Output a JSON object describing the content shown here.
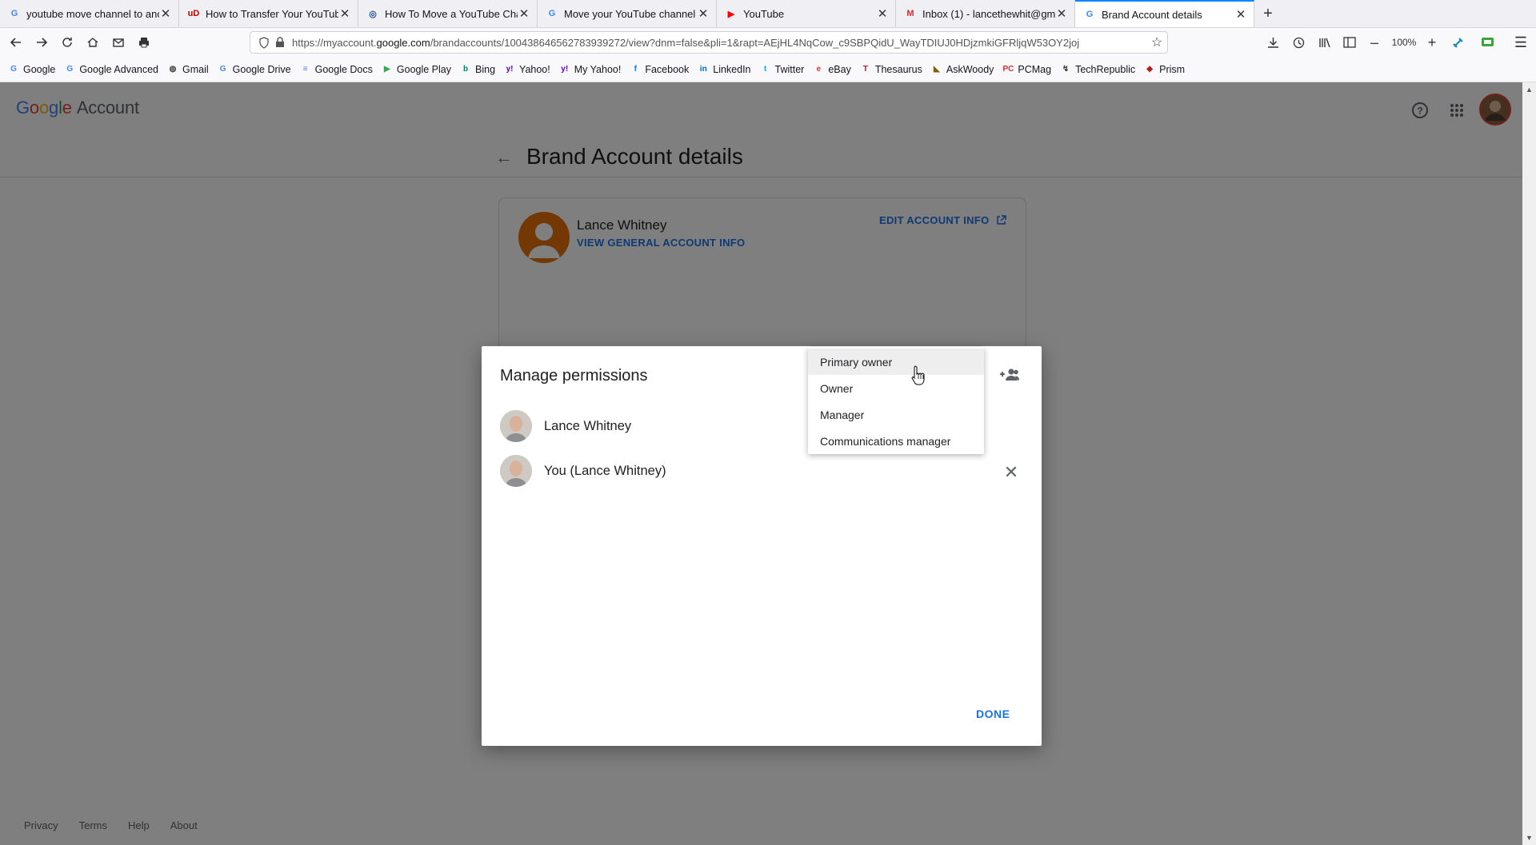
{
  "browser": {
    "tabs": [
      {
        "title": "youtube move channel to anot",
        "favicon": "google-icon",
        "favicon_glyph": "G",
        "favicon_color": "#4285f4"
      },
      {
        "title": "How to Transfer Your YouTube",
        "favicon": "ublock-icon",
        "favicon_glyph": "uD",
        "favicon_color": "#cc0000"
      },
      {
        "title": "How To Move a YouTube Chan",
        "favicon": "globe-icon",
        "favicon_glyph": "◎",
        "favicon_color": "#1a4fa0"
      },
      {
        "title": "Move your YouTube channel to",
        "favicon": "google-icon",
        "favicon_glyph": "G",
        "favicon_color": "#4285f4"
      },
      {
        "title": "YouTube",
        "favicon": "youtube-icon",
        "favicon_glyph": "▶",
        "favicon_color": "#ff0000"
      },
      {
        "title": "Inbox (1) - lancethewhit@gma",
        "favicon": "gmail-icon",
        "favicon_glyph": "M",
        "favicon_color": "#d93025"
      },
      {
        "title": "Brand Account details",
        "favicon": "google-icon",
        "favicon_glyph": "G",
        "favicon_color": "#4285f4",
        "active": true
      }
    ],
    "url_prefix": "https://myaccount.",
    "url_domain": "google.com",
    "url_rest": "/brandaccounts/100438646562783939272/view?dnm=false&pli=1&rapt=AEjHL4NqCow_c9SBPQidU_WayTDIUJ0HDjzmkiGFRljqW53OY2joj",
    "zoom": "100%",
    "bookmarks": [
      {
        "label": "Google",
        "icon": "google-icon",
        "glyph": "G",
        "color": "#4285f4"
      },
      {
        "label": "Google Advanced",
        "icon": "google-icon",
        "glyph": "G",
        "color": "#4285f4"
      },
      {
        "label": "Gmail",
        "icon": "globe-icon",
        "glyph": "◍",
        "color": "#444444"
      },
      {
        "label": "Google Drive",
        "icon": "google-icon",
        "glyph": "G",
        "color": "#4285f4"
      },
      {
        "label": "Google Docs",
        "icon": "docs-icon",
        "glyph": "≡",
        "color": "#4285f4"
      },
      {
        "label": "Google Play",
        "icon": "play-icon",
        "glyph": "▶",
        "color": "#34a853"
      },
      {
        "label": "Bing",
        "icon": "bing-icon",
        "glyph": "b",
        "color": "#008373"
      },
      {
        "label": "Yahoo!",
        "icon": "yahoo-icon",
        "glyph": "y!",
        "color": "#6001d2"
      },
      {
        "label": "My Yahoo!",
        "icon": "yahoo-icon",
        "glyph": "y!",
        "color": "#6001d2"
      },
      {
        "label": "Facebook",
        "icon": "facebook-icon",
        "glyph": "f",
        "color": "#1877f2"
      },
      {
        "label": "LinkedIn",
        "icon": "linkedin-icon",
        "glyph": "in",
        "color": "#0a66c2"
      },
      {
        "label": "Twitter",
        "icon": "twitter-icon",
        "glyph": "t",
        "color": "#1da1f2"
      },
      {
        "label": "eBay",
        "icon": "ebay-icon",
        "glyph": "e",
        "color": "#e53238"
      },
      {
        "label": "Thesaurus",
        "icon": "thesaurus-icon",
        "glyph": "T",
        "color": "#c8102e"
      },
      {
        "label": "AskWoody",
        "icon": "askwoody-icon",
        "glyph": "◣",
        "color": "#8a5a00"
      },
      {
        "label": "PCMag",
        "icon": "pcmag-icon",
        "glyph": "PC",
        "color": "#d32f2f"
      },
      {
        "label": "TechRepublic",
        "icon": "techrepublic-icon",
        "glyph": "↯",
        "color": "#333333"
      },
      {
        "label": "Prism",
        "icon": "prism-icon",
        "glyph": "◆",
        "color": "#b71c1c"
      }
    ]
  },
  "page": {
    "logo_google": "Google",
    "logo_account": "Account",
    "title": "Brand Account details",
    "account_name": "Lance Whitney",
    "view_info_link": "VIEW GENERAL ACCOUNT INFO",
    "edit_info_link": "EDIT ACCOUNT INFO",
    "footer": [
      "Privacy",
      "Terms",
      "Help",
      "About"
    ]
  },
  "dialog": {
    "title": "Manage permissions",
    "people": [
      {
        "name": "Lance Whitney",
        "role": "Primary owner"
      },
      {
        "name": "You (Lance Whitney)"
      }
    ],
    "role_options": [
      "Primary owner",
      "Owner",
      "Manager",
      "Communications manager"
    ],
    "highlighted_option": "Primary owner",
    "done_label": "DONE"
  },
  "colors": {
    "accent_blue": "#1a73e8",
    "overlay": "rgba(0,0,0,0.5)",
    "firefox_active_tab": "#0a84ff"
  }
}
